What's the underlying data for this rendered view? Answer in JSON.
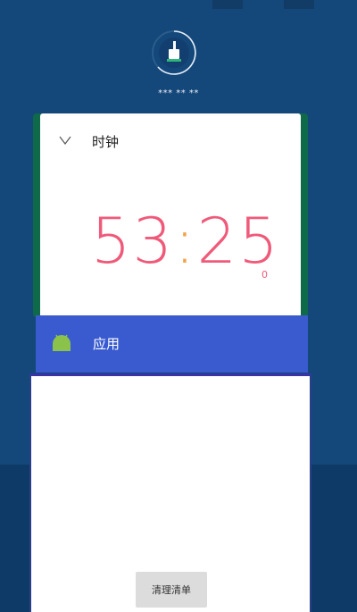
{
  "header": {
    "memory_label": "*** ** **"
  },
  "cards": [
    {
      "title": "时钟",
      "icon": "clock-icon",
      "time": {
        "minutes": "53",
        "separator": ":",
        "seconds": "25",
        "suffix": "0"
      }
    },
    {
      "title": "应用",
      "icon": "android-icon"
    }
  ],
  "actions": {
    "clean_label": "清理清单"
  },
  "colors": {
    "background": "#14477a",
    "accent_time": "#f05a7a",
    "app_bar": "#3a5bcf",
    "android_green": "#8bc34a"
  }
}
